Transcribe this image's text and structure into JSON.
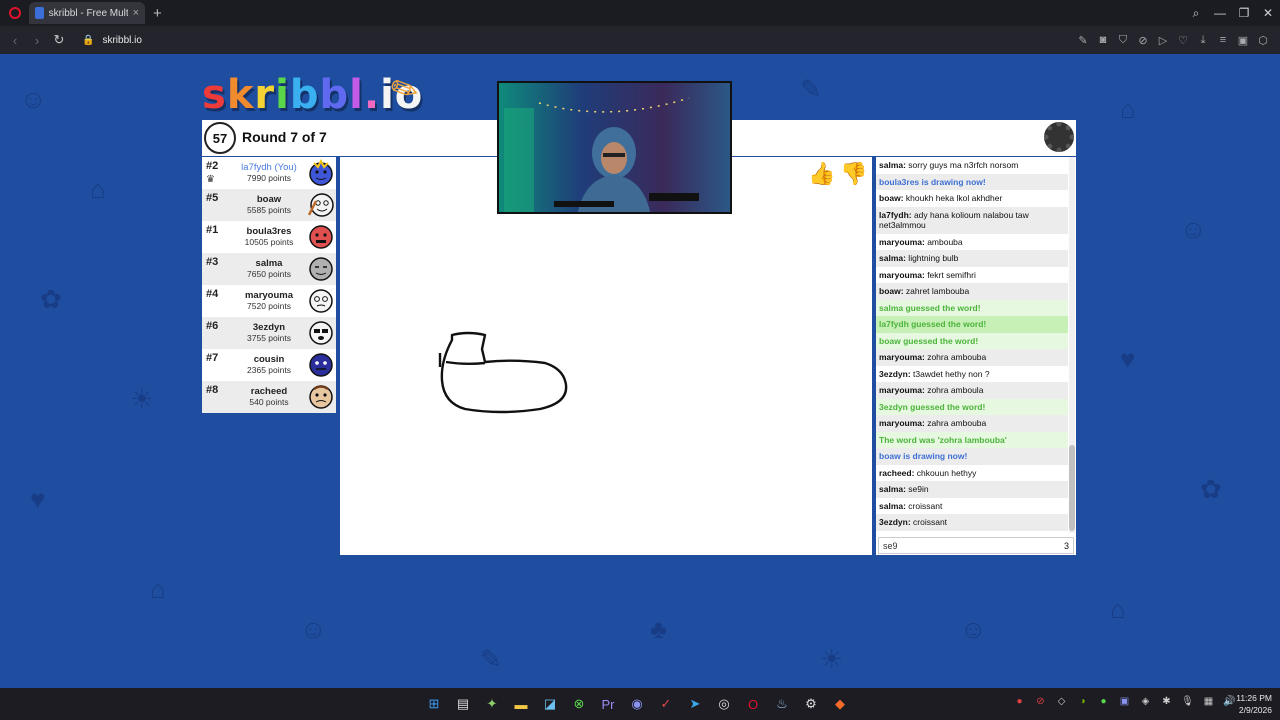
{
  "browser": {
    "tab_title": "skribbl - Free Multiplayer",
    "url": "skribbl.io",
    "new_tab": "+",
    "tab_close": "×"
  },
  "game": {
    "timer": "57",
    "round_text": "Round 7 of 7"
  },
  "players": [
    {
      "rank": "#2",
      "name": "la7fydh (You)",
      "points": "7990 points",
      "you": true,
      "color": "#3f56d8"
    },
    {
      "rank": "#5",
      "name": "boaw",
      "points": "5585 points",
      "color": "#f4f4f4"
    },
    {
      "rank": "#1",
      "name": "boula3res",
      "points": "10505 points",
      "color": "#e05050"
    },
    {
      "rank": "#3",
      "name": "salma",
      "points": "7650 points",
      "color": "#b0b0b0"
    },
    {
      "rank": "#4",
      "name": "maryouma",
      "points": "7520 points",
      "color": "#f4f4f4"
    },
    {
      "rank": "#6",
      "name": "3ezdyn",
      "points": "3755 points",
      "color": "#f4f4f4"
    },
    {
      "rank": "#7",
      "name": "cousin",
      "points": "2365 points",
      "color": "#2b2f9c"
    },
    {
      "rank": "#8",
      "name": "racheed",
      "points": "540 points",
      "color": "#e8c6a0"
    }
  ],
  "chat": {
    "messages": [
      {
        "type": "msg",
        "user": "salma:",
        "text": " sorry guys ma n3rfch norsom"
      },
      {
        "type": "draw",
        "text": "boula3res is drawing now!"
      },
      {
        "type": "msg",
        "user": "boaw:",
        "text": " khoukh heka lkol akhdher"
      },
      {
        "type": "msg",
        "user": "la7fydh:",
        "text": " ady hana kolioum nalabou taw net3almmou"
      },
      {
        "type": "msg",
        "user": "maryouma:",
        "text": " ambouba"
      },
      {
        "type": "msg",
        "user": "salma:",
        "text": " lightning bulb"
      },
      {
        "type": "msg",
        "user": "maryouma:",
        "text": " fekrt semifhri"
      },
      {
        "type": "msg",
        "user": "boaw:",
        "text": " zahret lambouba"
      },
      {
        "type": "guess",
        "text": "salma guessed the word!"
      },
      {
        "type": "guess alt",
        "text": "la7fydh guessed the word!"
      },
      {
        "type": "guess",
        "text": "boaw guessed the word!"
      },
      {
        "type": "msg",
        "user": "maryouma:",
        "text": " zohra ambouba"
      },
      {
        "type": "msg",
        "user": "3ezdyn:",
        "text": " t3awdet hethy non ?"
      },
      {
        "type": "msg",
        "user": "maryouma:",
        "text": " zohra amboula"
      },
      {
        "type": "guess",
        "text": "3ezdyn guessed the word!"
      },
      {
        "type": "msg",
        "user": "maryouma:",
        "text": " zahra ambouba"
      },
      {
        "type": "guess",
        "text": "The word was 'zohra lambouba'"
      },
      {
        "type": "draw",
        "text": "boaw is drawing now!"
      },
      {
        "type": "msg",
        "user": "racheed:",
        "text": " chkouun hethyy"
      },
      {
        "type": "msg",
        "user": "salma:",
        "text": " se9in"
      },
      {
        "type": "msg",
        "user": "salma:",
        "text": " croissant"
      },
      {
        "type": "msg",
        "user": "3ezdyn:",
        "text": " croissant"
      }
    ],
    "input_value": "se9",
    "char_count": "3"
  },
  "taskbar": {
    "time": "11:26 PM",
    "date": "2/9/2026"
  },
  "colors": {
    "page_bg": "#1f4ea0",
    "accent_you": "#4b7be4",
    "guess_green": "#4bb43a",
    "draw_blue": "#3e6fd4"
  }
}
